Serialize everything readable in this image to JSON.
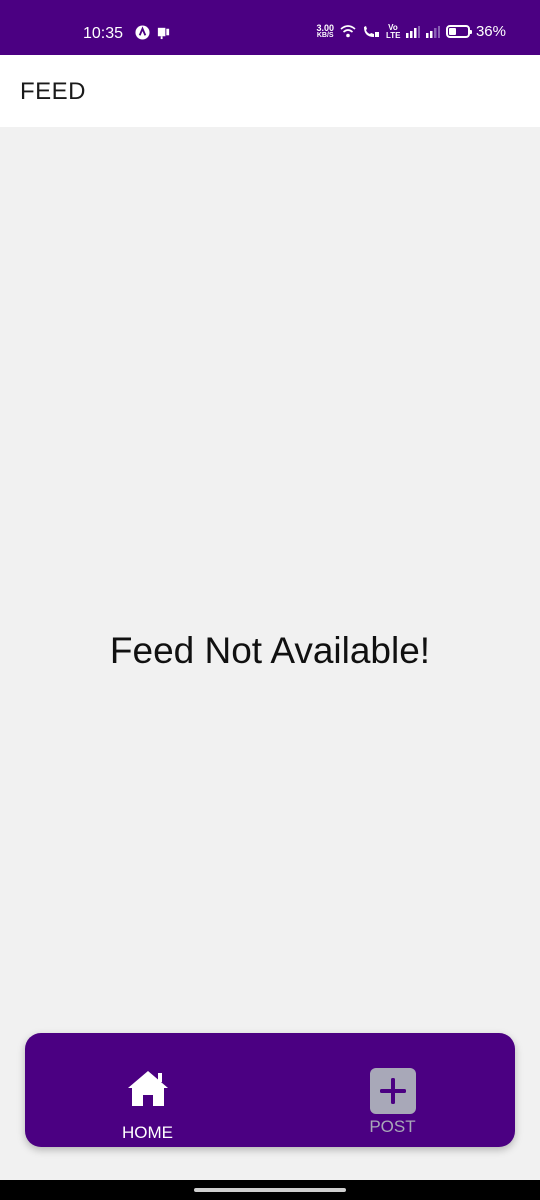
{
  "status_bar": {
    "time": "10:35",
    "net_speed_value": "3.00",
    "net_speed_unit": "KB/S",
    "volte": "Vo LTE",
    "battery": "36%"
  },
  "app_bar": {
    "title": "FEED"
  },
  "main": {
    "empty_message": "Feed Not Available!"
  },
  "bottom_nav": {
    "items": [
      {
        "label": "HOME",
        "icon": "home-icon",
        "active": true
      },
      {
        "label": "POST",
        "icon": "add-post-icon",
        "active": false
      }
    ]
  },
  "colors": {
    "primary": "#4b0082",
    "background": "#f1f1f1",
    "inactive": "#a8a8b8"
  }
}
